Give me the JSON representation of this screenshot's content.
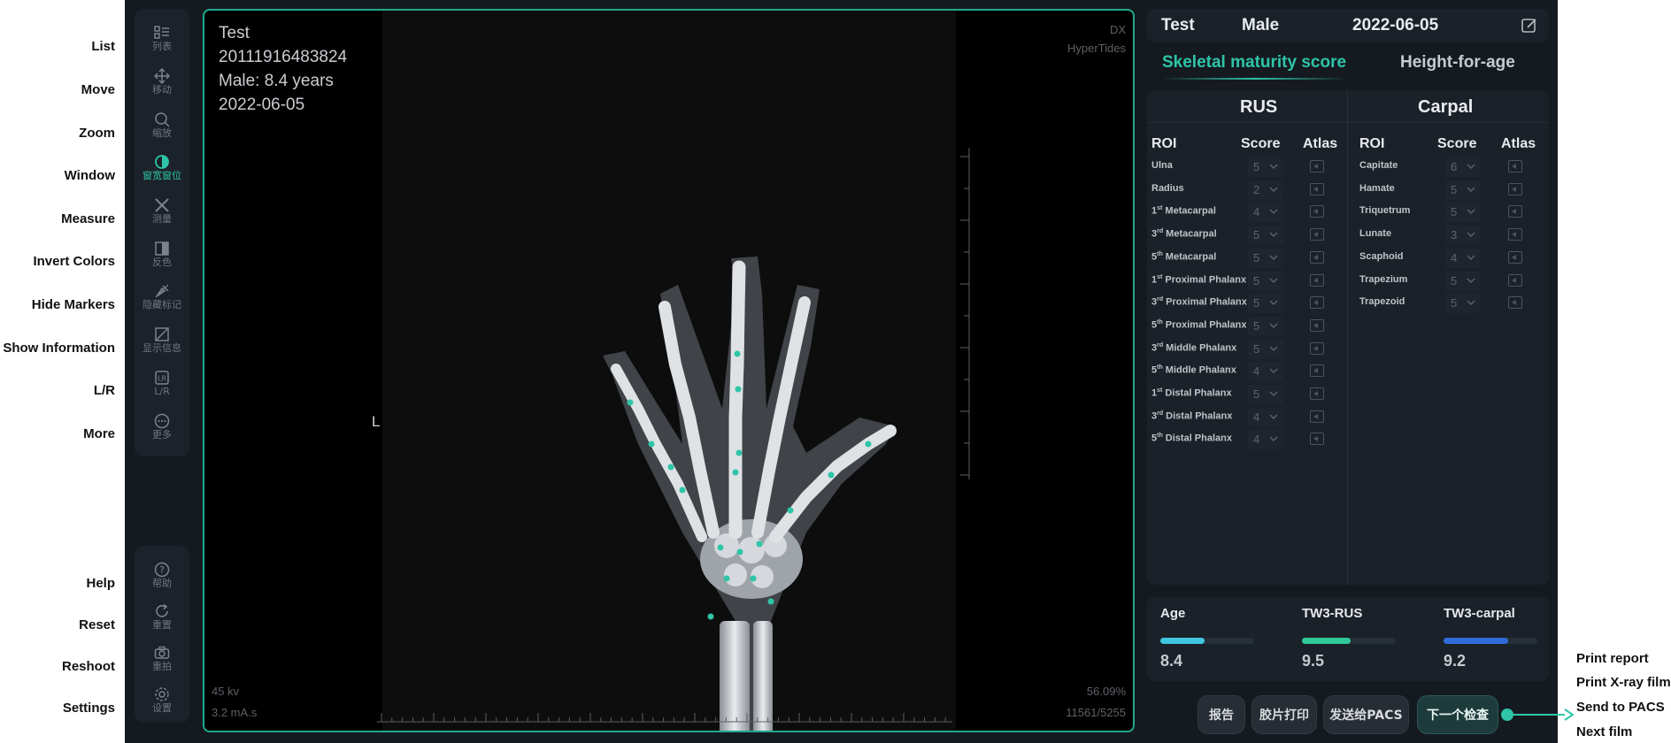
{
  "left_labels": [
    "List",
    "Move",
    "Zoom",
    "Window",
    "Measure",
    "Invert Colors",
    "Hide Markers",
    "Show Information",
    "L/R",
    "More",
    "Help",
    "Reset",
    "Reshoot",
    "Settings"
  ],
  "toolbar": {
    "top": [
      {
        "label": "列表",
        "icon": "list-icon"
      },
      {
        "label": "移动",
        "icon": "move-icon"
      },
      {
        "label": "缩放",
        "icon": "zoom-icon"
      },
      {
        "label": "窗宽窗位",
        "icon": "window-level-icon",
        "active": true
      },
      {
        "label": "测量",
        "icon": "measure-icon"
      },
      {
        "label": "反色",
        "icon": "invert-icon"
      },
      {
        "label": "隐藏标记",
        "icon": "hide-markers-icon"
      },
      {
        "label": "显示信息",
        "icon": "show-info-icon"
      },
      {
        "label": "L/R",
        "icon": "lr-icon"
      },
      {
        "label": "更多",
        "icon": "more-icon"
      }
    ],
    "bottom": [
      {
        "label": "帮助",
        "icon": "help-icon"
      },
      {
        "label": "重置",
        "icon": "reset-icon"
      },
      {
        "label": "重拍",
        "icon": "camera-icon"
      },
      {
        "label": "设置",
        "icon": "settings-icon"
      }
    ]
  },
  "viewer": {
    "patient_name": "Test",
    "patient_id": "20111916483824",
    "sex_age": "Male: 8.4 years",
    "date": "2022-06-05",
    "modality": "DX",
    "vendor": "HyperTides",
    "side_marker": "L",
    "kv": "45 kv",
    "mas": "3.2 mA.s",
    "zoom": "56.09%",
    "window": "11561/5255"
  },
  "header": {
    "name": "Test",
    "sex": "Male",
    "date": "2022-06-05"
  },
  "tabs": {
    "active": "Skeletal maturity score",
    "inactive": "Height-for-age"
  },
  "rus": {
    "title": "RUS",
    "columns": [
      "ROI",
      "Score",
      "Atlas"
    ],
    "rows": [
      {
        "pre": "",
        "sup": "",
        "name": "Ulna",
        "score": "5"
      },
      {
        "pre": "",
        "sup": "",
        "name": "Radius",
        "score": "2"
      },
      {
        "pre": "1",
        "sup": "st",
        "name": " Metacarpal",
        "score": "4"
      },
      {
        "pre": "3",
        "sup": "rd",
        "name": " Metacarpal",
        "score": "5"
      },
      {
        "pre": "5",
        "sup": "th",
        "name": " Metacarpal",
        "score": "5"
      },
      {
        "pre": "1",
        "sup": "st",
        "name": " Proximal Phalanx",
        "score": "5"
      },
      {
        "pre": "3",
        "sup": "rd",
        "name": " Proximal Phalanx",
        "score": "5"
      },
      {
        "pre": "5",
        "sup": "th",
        "name": " Proximal Phalanx",
        "score": "5"
      },
      {
        "pre": "3",
        "sup": "rd",
        "name": " Middle Phalanx",
        "score": "5"
      },
      {
        "pre": "5",
        "sup": "th",
        "name": " Middle Phalanx",
        "score": "4"
      },
      {
        "pre": "1",
        "sup": "st",
        "name": " Distal Phalanx",
        "score": "5"
      },
      {
        "pre": "3",
        "sup": "rd",
        "name": " Distal Phalanx",
        "score": "4"
      },
      {
        "pre": "5",
        "sup": "th",
        "name": " Distal Phalanx",
        "score": "4"
      }
    ]
  },
  "carpal": {
    "title": "Carpal",
    "columns": [
      "ROI",
      "Score",
      "Atlas"
    ],
    "rows": [
      {
        "name": "Capitate",
        "score": "6"
      },
      {
        "name": "Hamate",
        "score": "5"
      },
      {
        "name": "Triquetrum",
        "score": "5"
      },
      {
        "name": "Lunate",
        "score": "3"
      },
      {
        "name": "Scaphoid",
        "score": "4"
      },
      {
        "name": "Trapezium",
        "score": "5"
      },
      {
        "name": "Trapezoid",
        "score": "5"
      }
    ]
  },
  "metrics": [
    {
      "label": "Age",
      "value": "8.4",
      "fill": 0.47,
      "color": "#3fc6e0"
    },
    {
      "label": "TW3-RUS",
      "value": "9.5",
      "fill": 0.52,
      "color": "#2fc99a"
    },
    {
      "label": "TW3-carpal",
      "value": "9.2",
      "fill": 0.69,
      "color": "#2f6bd8"
    }
  ],
  "actions": [
    "报告",
    "胶片打印",
    "发送给PACS",
    "下一个检查"
  ],
  "right_labels": [
    "Print report",
    "Print X-ray film",
    "Send to PACS",
    "Next film"
  ],
  "colors": {
    "accent": "#2ec5a8",
    "panel": "#1b2128",
    "background": "#151a20"
  }
}
